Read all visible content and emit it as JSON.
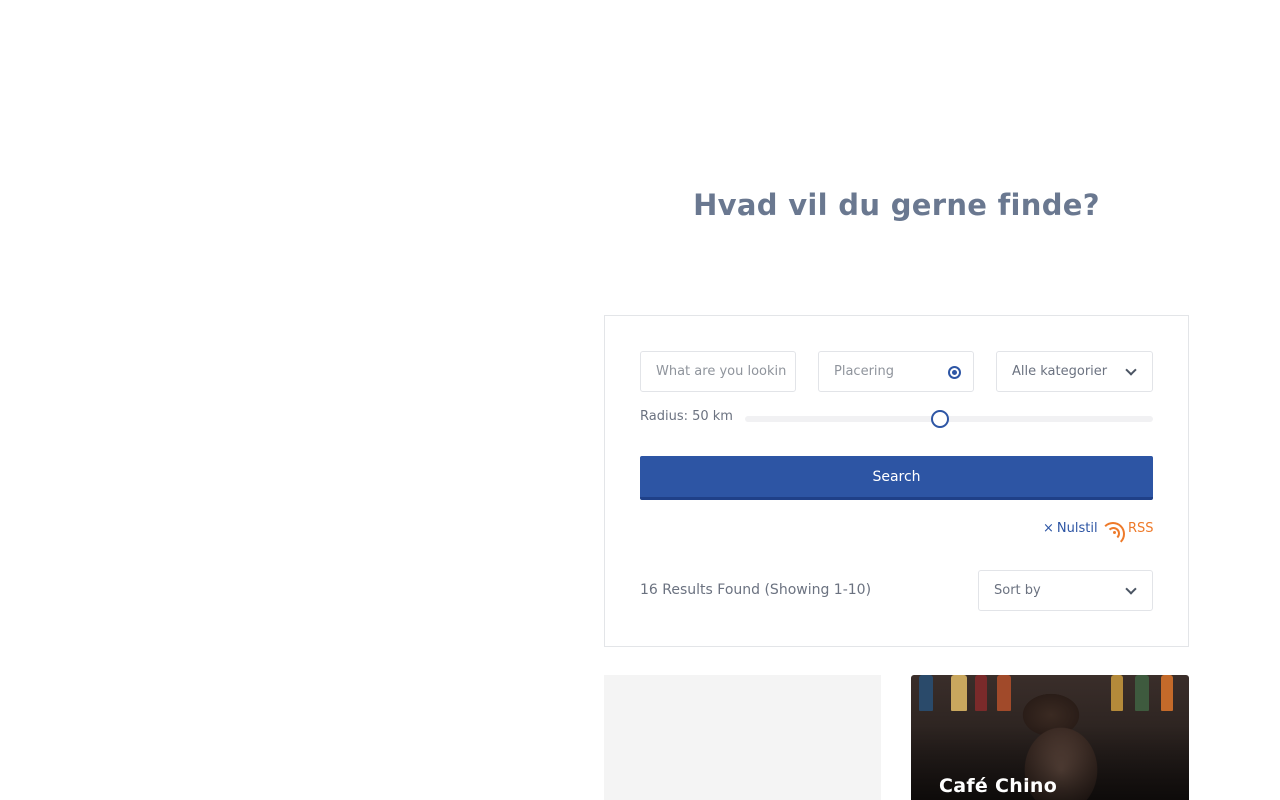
{
  "hero": {
    "heading": "Hvad vil du gerne finde?"
  },
  "search": {
    "keyword_placeholder": "What are you looking for?",
    "location_placeholder": "Placering",
    "category_selected": "Alle kategorier",
    "radius_label": "Radius: 50 km",
    "radius_value_fraction": 0.48,
    "search_button_label": "Search",
    "reset_label": "Nulstil",
    "rss_label": "RSS",
    "results_count": "16 Results Found (Showing 1-10)",
    "sort_selected": "Sort by"
  },
  "listings": [
    {
      "title": ""
    },
    {
      "title": "Café Chino"
    }
  ],
  "colors": {
    "accent": "#2d55a4",
    "rss": "#ee7a2a",
    "heading": "#6a7890",
    "text": "#6b7280"
  },
  "icons": {
    "locate": "crosshair-locate-icon",
    "chevron": "chevron-down-icon",
    "reset": "close-icon",
    "rss": "rss-icon"
  }
}
